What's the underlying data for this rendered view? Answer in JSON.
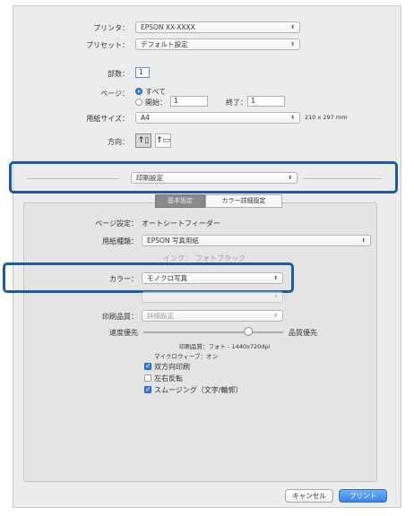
{
  "printer": {
    "label": "プリンタ：",
    "value": "EPSON XX-XXXX"
  },
  "preset": {
    "label": "プリセット：",
    "value": "デフォルト設定"
  },
  "copies": {
    "label": "部数：",
    "value": "1"
  },
  "pages": {
    "label": "ページ：",
    "all_label": "すべて",
    "from_label": "開始：",
    "from_value": "1",
    "to_label": "終了：",
    "to_value": "1",
    "selected": "all"
  },
  "paper_size": {
    "label": "用紙サイズ：",
    "value": "A4",
    "dimensions": "210 x 297 mm"
  },
  "orientation": {
    "label": "方向：",
    "portrait_glyph": "↑▯",
    "landscape_glyph": "↑▭",
    "selected": "portrait"
  },
  "section_popup": {
    "value": "印刷設定"
  },
  "tabs": [
    {
      "label": "基本設定",
      "active": true
    },
    {
      "label": "カラー詳細設定",
      "active": false
    }
  ],
  "page_setup": {
    "label": "ページ設定：",
    "value": "オートシートフィーダー"
  },
  "media_type": {
    "label": "用紙種類：",
    "value": "EPSON 写真用紙"
  },
  "ink": {
    "label": "インク：",
    "value": "フォトブラック"
  },
  "color": {
    "label": "カラー：",
    "value": "モノクロ写真"
  },
  "color_settings": {
    "value": ""
  },
  "print_quality": {
    "label": "印刷品質：",
    "value": "詳細設定"
  },
  "speed_quality": {
    "left_label": "速度優先",
    "right_label": "品質優先",
    "level": 0.75,
    "quality_info": "印刷品質：フォト - 1440x720dpi",
    "microweave": "マイクロウィーブ：オン"
  },
  "options": [
    {
      "label": "双方向印刷",
      "checked": true
    },
    {
      "label": "左右反転",
      "checked": false
    },
    {
      "label": "スムージング（文字/輪郭）",
      "checked": true
    }
  ],
  "buttons": {
    "cancel": "キャンセル",
    "print": "プリント"
  },
  "colors": {
    "highlight": "#1a5c9e",
    "accent": "#3a86e6"
  }
}
